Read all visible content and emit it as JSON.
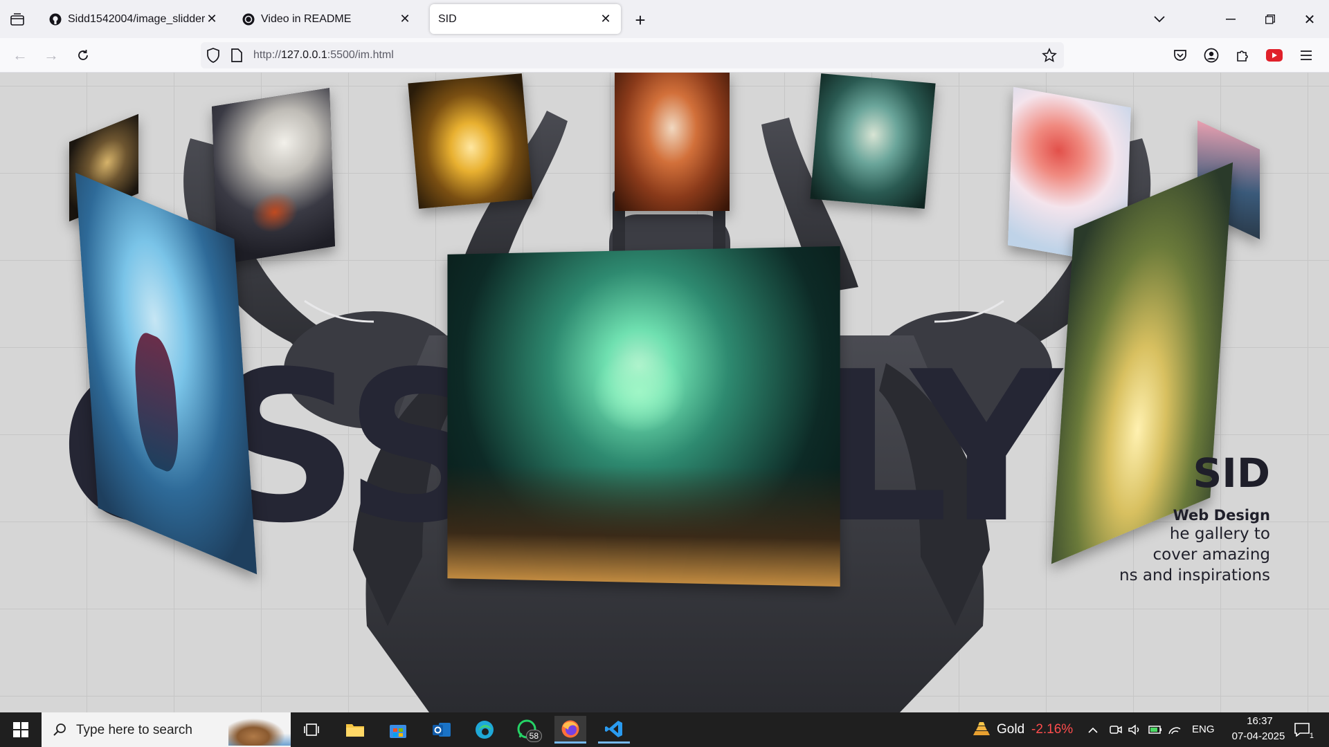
{
  "browser": {
    "tabs": [
      {
        "title": "Sidd1542004/image_slidder",
        "favicon": "github-icon"
      },
      {
        "title": "Video in README",
        "favicon": "chatgpt-icon"
      },
      {
        "title": "SID",
        "favicon": "none"
      }
    ],
    "url_prefix": "http://",
    "url_host": "127.0.0.1",
    "url_rest": ":5500/im.html"
  },
  "page": {
    "big_word_left": "CSS",
    "big_word_right": "LY",
    "brand": "SID",
    "subtitle": "Web Design",
    "description_lines": [
      "he gallery to",
      "cover amazing",
      "ns and inspirations"
    ]
  },
  "gallery_cards": [
    {
      "name": "dragon-card-gold-small",
      "colors": [
        "#3a2f1f",
        "#a98a4a",
        "#1b1610"
      ]
    },
    {
      "name": "dragon-card-dark-moon",
      "colors": [
        "#e9e7e2",
        "#3a3a44",
        "#7a3a1e"
      ]
    },
    {
      "name": "dragon-card-golden",
      "colors": [
        "#2a1c0a",
        "#e8b030",
        "#5a3a10"
      ]
    },
    {
      "name": "dragon-card-red",
      "colors": [
        "#6a2f1a",
        "#d2703a",
        "#f1d8c0"
      ]
    },
    {
      "name": "dragon-card-teal",
      "colors": [
        "#1c3a36",
        "#6aa59a",
        "#d8e4d4"
      ]
    },
    {
      "name": "dragon-card-pink-cloud",
      "colors": [
        "#f4e4ec",
        "#e2504a",
        "#bfd3e8"
      ]
    },
    {
      "name": "dragon-card-edge",
      "colors": [
        "#3a5a7a",
        "#e8a0b0",
        "#2a3a4a"
      ]
    },
    {
      "name": "dragon-card-ice",
      "colors": [
        "#1e3f5e",
        "#7ac4e8",
        "#c6e6f4"
      ]
    },
    {
      "name": "dragon-card-jade-main",
      "colors": [
        "#0d2a26",
        "#6fe0b0",
        "#e8d8a0"
      ]
    },
    {
      "name": "dragon-card-golden-mist",
      "colors": [
        "#2a3a2a",
        "#d8c060",
        "#fff1b0"
      ]
    }
  ],
  "taskbar": {
    "search_placeholder": "Type here to search",
    "whatsapp_badge": "58",
    "weather_label": "Gold",
    "weather_value": "-2.16%",
    "language": "ENG",
    "time": "16:37",
    "date": "07-04-2025",
    "notification_count": "1"
  },
  "colors": {
    "accent_red": "#ff4d4d",
    "page_bg": "#d6d6d6",
    "text_dark": "#252634"
  }
}
